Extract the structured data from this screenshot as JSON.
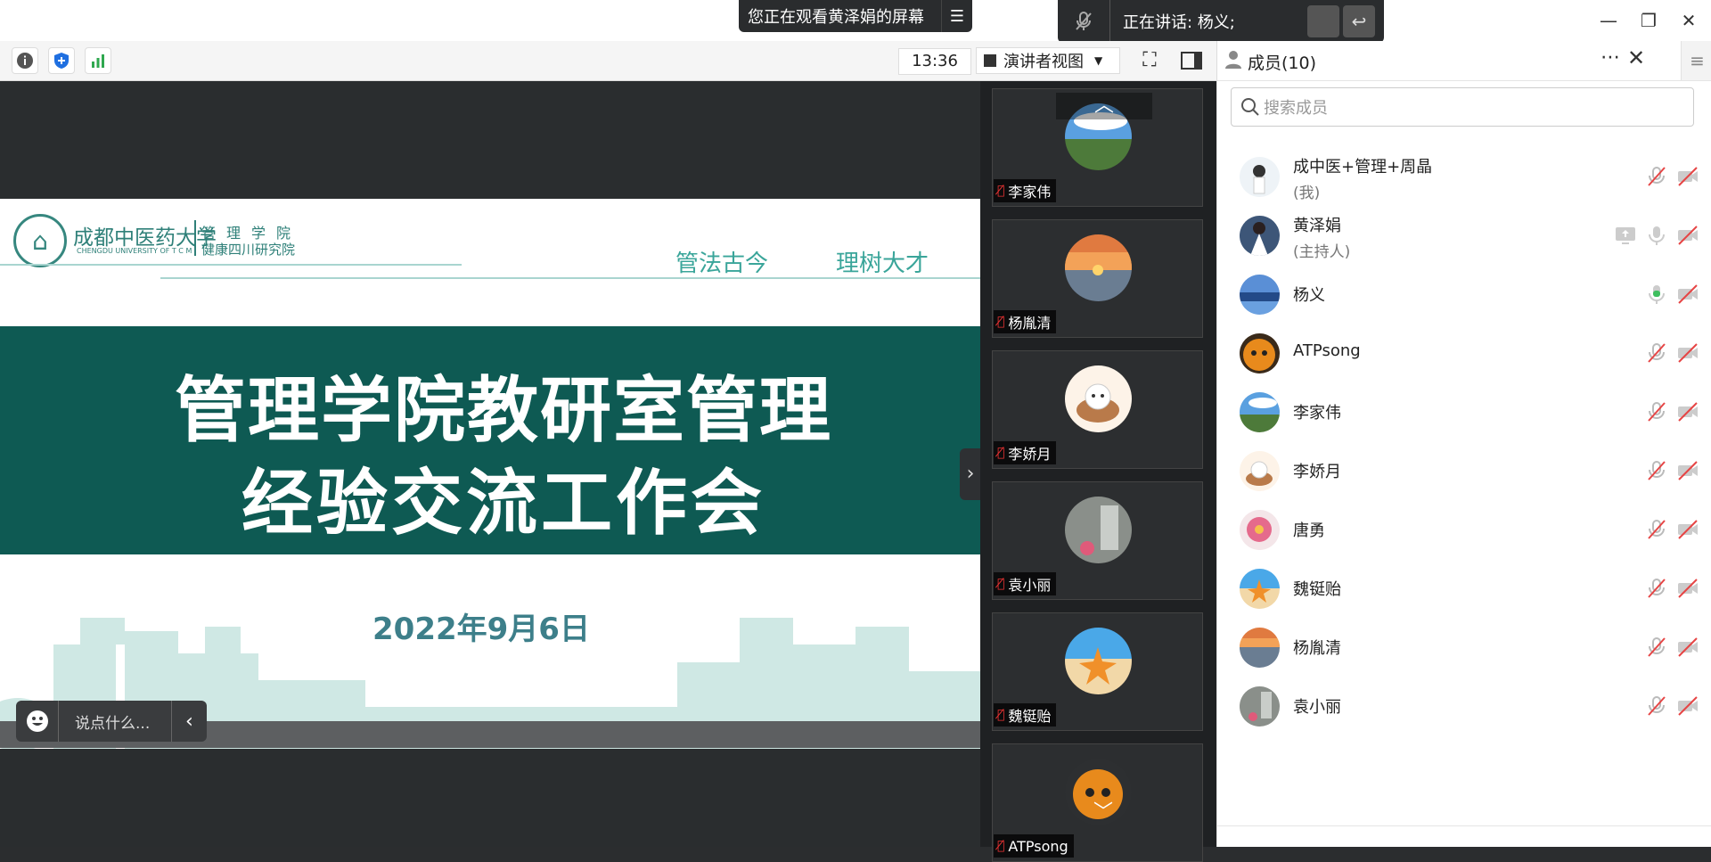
{
  "banner": {
    "sharing_text": "您正在观看黄泽娟的屏幕",
    "speaking_text": "正在讲话: 杨义;"
  },
  "toolbar": {
    "time": "13:36",
    "view_label": "演讲者视图"
  },
  "slide": {
    "school_cn": "成都中医药大学",
    "school_en": "CHENGDU UNIVERSITY OF T C M",
    "dept_line1": "管理学院",
    "dept_line2": "健康四川研究院",
    "motto_1": "管法古今",
    "motto_2": "理树大才",
    "title_line1": "管理学院教研室管理",
    "title_line2": "经验交流工作会",
    "date": "2022年9月6日"
  },
  "chat": {
    "placeholder": "说点什么..."
  },
  "video_tiles": [
    {
      "name": "李家伟",
      "avatar": "sky-field"
    },
    {
      "name": "杨胤清",
      "avatar": "sunset"
    },
    {
      "name": "李娇月",
      "avatar": "cartoon-bunny"
    },
    {
      "name": "袁小丽",
      "avatar": "flower-cup"
    },
    {
      "name": "魏铤贻",
      "avatar": "starfish-beach"
    },
    {
      "name": "ATPsong",
      "avatar": "orange-face"
    }
  ],
  "members_panel": {
    "title": "成员(10)",
    "search_placeholder": "搜索成员",
    "members": [
      {
        "name": "成中医+管理+周晶",
        "role": "(我)",
        "avatar": "person-light"
      },
      {
        "name": "黄泽娟",
        "role": "(主持人)",
        "avatar": "person-white-dress",
        "sharing": true
      },
      {
        "name": "杨义",
        "role": "",
        "avatar": "lake",
        "speaking": true
      },
      {
        "name": "ATPsong",
        "role": "",
        "avatar": "orange-face"
      },
      {
        "name": "李家伟",
        "role": "",
        "avatar": "sky-field"
      },
      {
        "name": "李娇月",
        "role": "",
        "avatar": "cartoon-bunny"
      },
      {
        "name": "唐勇",
        "role": "",
        "avatar": "pink-flower"
      },
      {
        "name": "魏铤贻",
        "role": "",
        "avatar": "starfish-beach"
      },
      {
        "name": "杨胤清",
        "role": "",
        "avatar": "sunset"
      },
      {
        "name": "袁小丽",
        "role": "",
        "avatar": "flower-cup"
      }
    ]
  },
  "colors": {
    "slide_band": "#0e5a53",
    "accent_teal": "#2f8079",
    "mic_muted": "#e64545",
    "mic_active": "#3fbf5f"
  }
}
